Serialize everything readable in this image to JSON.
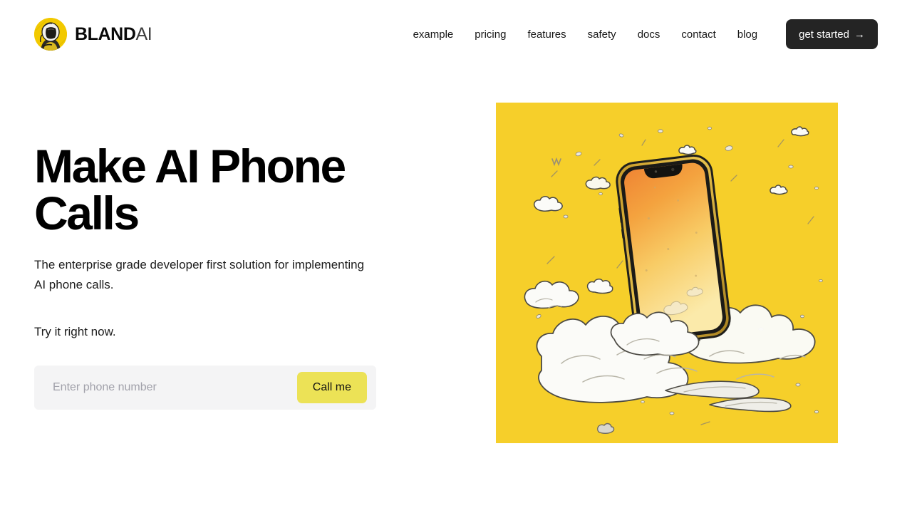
{
  "brand": {
    "bold": "BLAND",
    "light": "AI",
    "avatar_icon": "astronaut-avatar-icon",
    "avatar_bg": "#f2c900"
  },
  "nav": {
    "items": [
      {
        "label": "example"
      },
      {
        "label": "pricing"
      },
      {
        "label": "features"
      },
      {
        "label": "safety"
      },
      {
        "label": "docs"
      },
      {
        "label": "contact"
      },
      {
        "label": "blog"
      }
    ],
    "cta": {
      "label": "get started",
      "arrow": "→",
      "bg": "#242424",
      "color": "#ffffff"
    }
  },
  "hero": {
    "headline": "Make AI Phone Calls",
    "subtitle": "The enterprise grade developer first solution for implementing AI phone calls.",
    "subtitle_second": "Try it right now."
  },
  "form": {
    "placeholder": "Enter phone number",
    "value": "",
    "button_label": "Call me",
    "button_bg": "#ece256",
    "field_bg": "#f4f4f5"
  },
  "illustration": {
    "alt": "Smartphone rising out of hand-drawn clouds on a yellow panel",
    "panel_color": "#f6cf2a",
    "cloud_color": "#fbfbf9",
    "screen_gradient_top": "#f0893a",
    "screen_gradient_bottom": "#fbe9a8"
  }
}
